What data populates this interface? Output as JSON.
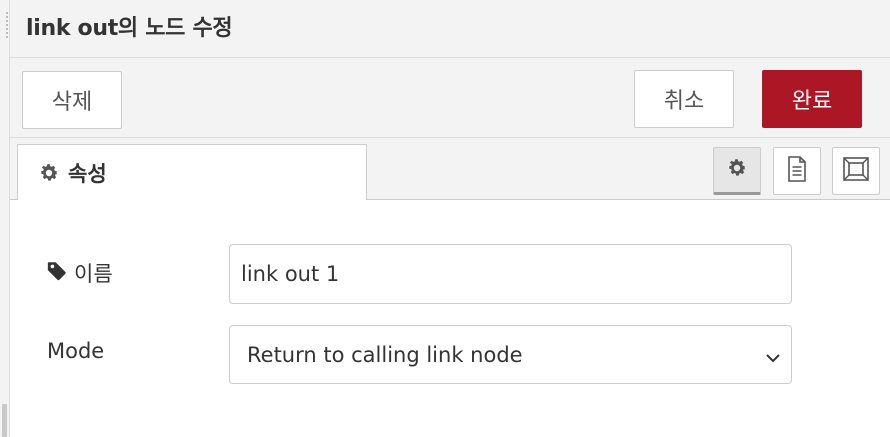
{
  "header": {
    "title": "link out의 노드 수정"
  },
  "toolbar": {
    "delete_label": "삭제",
    "cancel_label": "취소",
    "done_label": "완료",
    "done_color": "#ad1625"
  },
  "tabs": {
    "properties_label": "속성",
    "icons": [
      "gear-icon",
      "document-icon",
      "frame-icon"
    ]
  },
  "form": {
    "name_label": "이름",
    "name_value": "link out 1",
    "mode_label": "Mode",
    "mode_value": "Return to calling link node"
  }
}
